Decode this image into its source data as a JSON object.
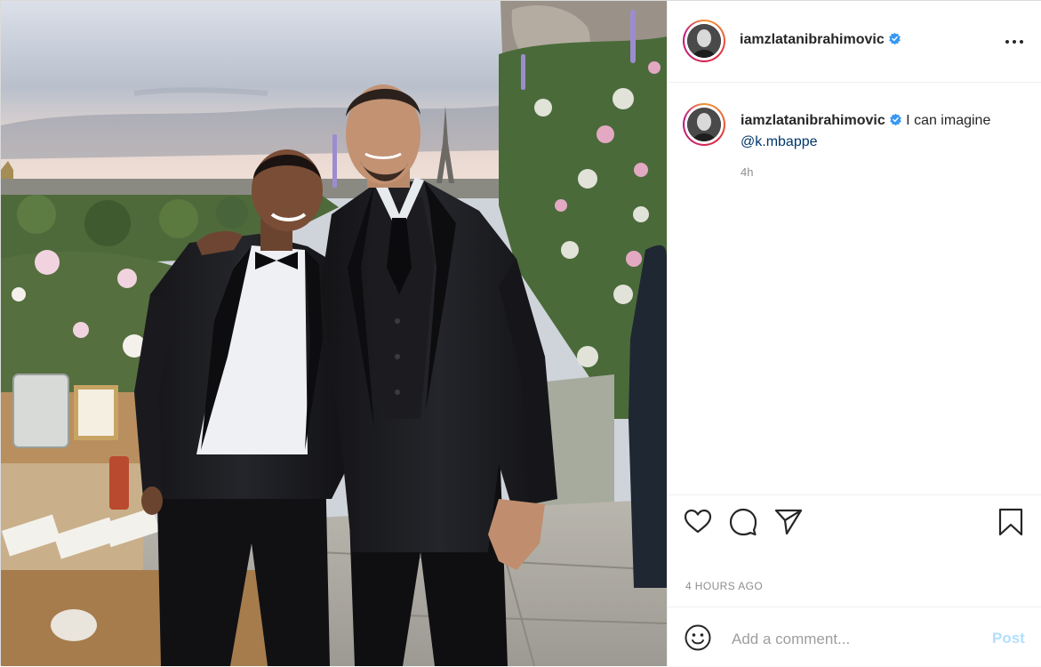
{
  "post": {
    "username": "iamzlatanibrahimovic",
    "verified": true,
    "caption": {
      "username": "iamzlatanibrahimovic",
      "text": "I can imagine",
      "mention": "@k.mbappe",
      "time": "4h"
    },
    "timestamp": "4 HOURS AGO"
  },
  "header": {
    "more_icon": "more-options-icon"
  },
  "actions": {
    "like_icon": "heart-icon",
    "comment_icon": "comment-icon",
    "share_icon": "paper-plane-icon",
    "save_icon": "bookmark-icon"
  },
  "comment_box": {
    "placeholder": "Add a comment...",
    "post_label": "Post",
    "emoji_icon": "smiley-icon"
  },
  "colors": {
    "verified": "#3897f0",
    "mention": "#00376b",
    "post_button_disabled": "#b2dffc",
    "muted_text": "#8e8e8e"
  }
}
